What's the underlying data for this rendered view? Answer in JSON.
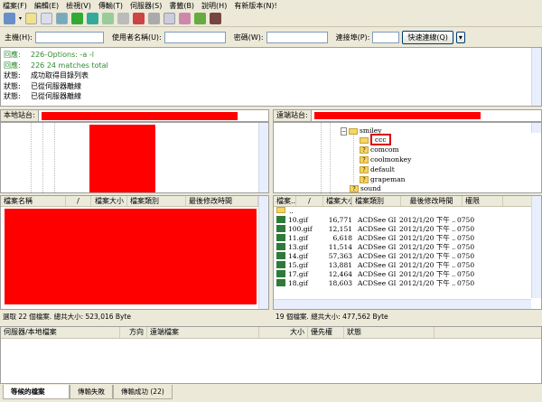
{
  "menu": [
    "檔案(F)",
    "編輯(E)",
    "檢視(V)",
    "傳輸(T)",
    "伺服器(S)",
    "書籤(B)",
    "說明(H)",
    "有新版本(N)!"
  ],
  "quickconnect": {
    "host_label": "主機(H):",
    "user_label": "使用者名稱(U):",
    "pass_label": "密碼(W):",
    "port_label": "連接埠(P):",
    "button": "快速連線(Q)",
    "host": "",
    "user": "",
    "pass": "",
    "port": ""
  },
  "log": [
    {
      "k": "回應:",
      "v": "226-Options: -a -l",
      "type": "response"
    },
    {
      "k": "回應:",
      "v": "226 24 matches total",
      "type": "response"
    },
    {
      "k": "狀態:",
      "v": "成功取得目錄列表",
      "type": "status"
    },
    {
      "k": "狀態:",
      "v": "已從伺服器離線",
      "type": "status"
    },
    {
      "k": "狀態:",
      "v": "已從伺服器離線",
      "type": "status"
    }
  ],
  "local": {
    "site_label": "本地站台:",
    "columns": [
      "檔案名稱",
      "/",
      "檔案大小",
      "檔案類別",
      "最後修改時間"
    ],
    "status": "選取 22 個檔案. 總共大小: 523,016 Byte"
  },
  "remote": {
    "site_label": "遠端站台:",
    "tree": {
      "parent": "smiley",
      "children": [
        "ccc",
        "comcom",
        "coolmonkey",
        "default",
        "grapeman"
      ],
      "sibling": "sound"
    },
    "columns": [
      "檔案...",
      "/",
      "檔案大小",
      "檔案類別",
      "最後修改時間",
      "權限"
    ],
    "parent_dir": "..",
    "files": [
      {
        "name": "10.gif",
        "size": "16,771",
        "type": "ACDSee GI...",
        "date": "2012/1/20 下午 ...",
        "perm": "0750"
      },
      {
        "name": "100.gif",
        "size": "12,151",
        "type": "ACDSee GI...",
        "date": "2012/1/20 下午 ...",
        "perm": "0750"
      },
      {
        "name": "11.gif",
        "size": "6,618",
        "type": "ACDSee GI...",
        "date": "2012/1/20 下午 ...",
        "perm": "0750"
      },
      {
        "name": "13.gif",
        "size": "11,514",
        "type": "ACDSee GI...",
        "date": "2012/1/20 下午 ...",
        "perm": "0750"
      },
      {
        "name": "14.gif",
        "size": "57,363",
        "type": "ACDSee GI...",
        "date": "2012/1/20 下午 ...",
        "perm": "0750"
      },
      {
        "name": "15.gif",
        "size": "13,881",
        "type": "ACDSee GI...",
        "date": "2012/1/20 下午 ...",
        "perm": "0750"
      },
      {
        "name": "17.gif",
        "size": "12,464",
        "type": "ACDSee GI...",
        "date": "2012/1/20 下午 ...",
        "perm": "0750"
      },
      {
        "name": "18.gif",
        "size": "18,603",
        "type": "ACDSee GI...",
        "date": "2012/1/20 下午 ...",
        "perm": "0750"
      }
    ],
    "status": "19 個檔案. 總共大小: 477,562 Byte"
  },
  "queue": {
    "columns": [
      "伺服器/本地檔案",
      "方向",
      "遠端檔案",
      "大小",
      "優先權",
      "狀態"
    ]
  },
  "tabs": [
    "等候的檔案",
    "傳輸失敗",
    "傳輸成功 (22)"
  ]
}
